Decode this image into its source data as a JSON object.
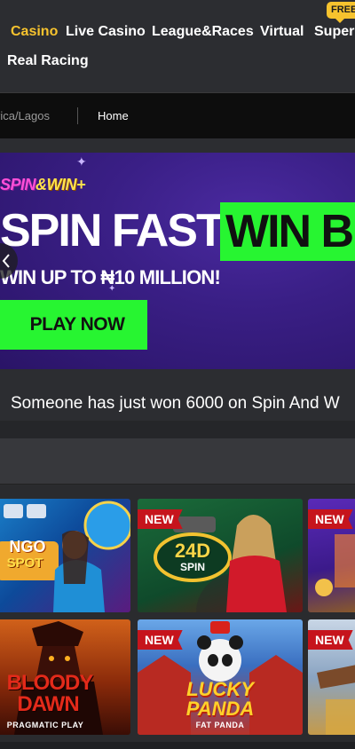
{
  "nav": {
    "items": [
      {
        "label": "Casino",
        "active": true
      },
      {
        "label": "Live Casino",
        "active": false
      },
      {
        "label": "League&Races",
        "active": false
      },
      {
        "label": "Virtual",
        "active": false
      },
      {
        "label": "Super",
        "active": false
      },
      {
        "label": "Real Racing",
        "active": false
      }
    ],
    "free_badge": "FREE"
  },
  "breadcrumb": {
    "region": "rica/Lagos",
    "home": "Home"
  },
  "banner": {
    "logo_spin": "SPIN",
    "logo_amp": "&",
    "logo_win": "WIN",
    "logo_plus": "+",
    "headline": "SPIN FAST,",
    "headline_highlight": "WIN BI",
    "subline": "WIN UP TO ₦10 MILLION!",
    "cta": "PLAY NOW"
  },
  "ticker": {
    "text": "Someone has just won 6000 on Spin And W"
  },
  "games": [
    {
      "title_line1": "NGO",
      "title_line2": "SPOT",
      "badge": "",
      "caption": ""
    },
    {
      "title_line1": "24D",
      "title_line2": "SPIN",
      "badge": "NEW",
      "caption": ""
    },
    {
      "title_line1": "",
      "title_line2": "",
      "badge": "NEW",
      "caption": ""
    },
    {
      "title_line1": "BLOODY",
      "title_line2": "DAWN",
      "badge": "",
      "caption": "PRAGMATIC PLAY"
    },
    {
      "title_line1": "LUCKY",
      "title_line2": "PANDA",
      "badge": "NEW",
      "caption": "FAT PANDA"
    },
    {
      "title_line1": "",
      "title_line2": "",
      "badge": "NEW",
      "caption": ""
    }
  ],
  "colors": {
    "accent": "#f7c32e",
    "cta_green": "#27f531",
    "new_badge": "#c6141c",
    "banner_purple": "#3a1f86"
  }
}
